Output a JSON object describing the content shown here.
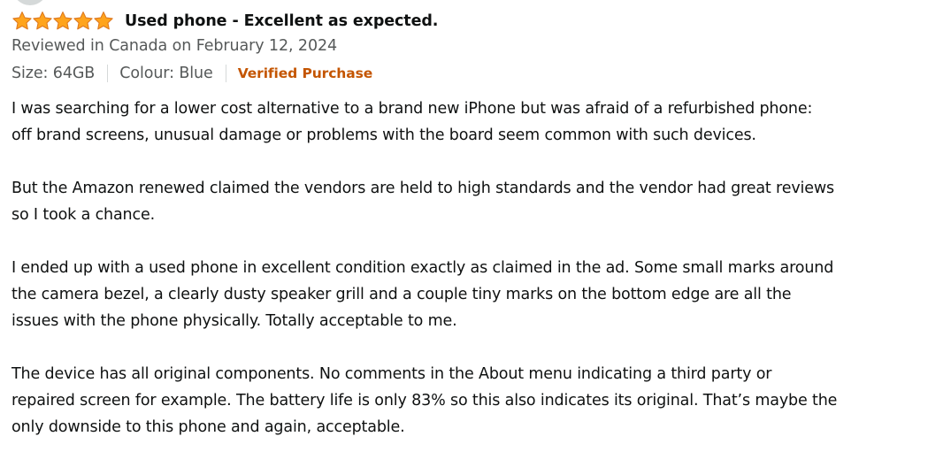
{
  "review": {
    "rating": 5,
    "star_color": "#ffa41c",
    "star_outline_color": "#de7921",
    "title": "Used phone - Excellent as expected.",
    "date": "Reviewed in Canada on February 12, 2024",
    "format": {
      "size": "Size: 64GB",
      "colour": "Colour: Blue"
    },
    "verified_label": "Verified Purchase",
    "verified_color": "#c45500",
    "paragraphs": [
      {
        "lines": [
          "I was searching for a lower cost alternative to a brand new iPhone but was afraid of a refurbished phone:",
          "off brand screens, unusual damage or problems with the board seem common with such devices."
        ]
      },
      {
        "lines": [
          "But the Amazon renewed claimed the vendors are held to high standards and the vendor had great reviews",
          "so I took a chance."
        ]
      },
      {
        "lines": [
          "I ended up with a used phone in excellent condition exactly as claimed in the ad. Some small marks around",
          "the camera bezel, a clearly dusty speaker grill and a couple tiny marks on the bottom edge are all the",
          "issues with the phone physically. Totally acceptable to me."
        ]
      },
      {
        "lines": [
          "The device has all original components. No comments in the About menu indicating a third party or",
          "repaired screen for example. The battery life is only 83% so this also indicates its original. That’s maybe the",
          "only downside to this phone and again, acceptable."
        ]
      }
    ]
  }
}
